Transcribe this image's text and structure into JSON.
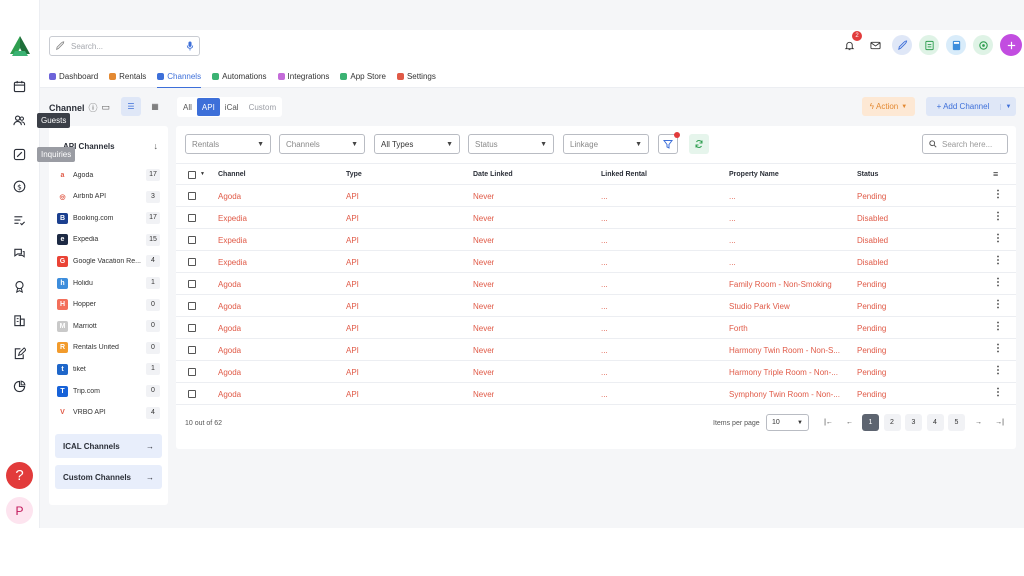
{
  "rail": {
    "tooltips": [
      "Guests",
      "Inquiries"
    ],
    "help_label": "?",
    "avatar_label": "P"
  },
  "topbar": {
    "search_placeholder": "Search...",
    "notification_count": "2"
  },
  "nav_tabs": [
    {
      "label": "Dashboard",
      "color": "#6c63d9"
    },
    {
      "label": "Rentals",
      "color": "#e38932"
    },
    {
      "label": "Channels",
      "color": "#3d6fd9",
      "active": true
    },
    {
      "label": "Automations",
      "color": "#3bb273"
    },
    {
      "label": "Integrations",
      "color": "#c46bd9"
    },
    {
      "label": "App Store",
      "color": "#3bb273"
    },
    {
      "label": "Settings",
      "color": "#e05a47"
    }
  ],
  "channel_header": {
    "title": "Channel",
    "filter_tabs": [
      "All",
      "API",
      "iCal",
      "Custom"
    ],
    "action_label": "Action",
    "add_channel_label": "+ Add Channel"
  },
  "sidebar": {
    "heading": "API Channels",
    "items": [
      {
        "name": "Agoda",
        "count": "17",
        "color": "#ffffff",
        "glyph": "a"
      },
      {
        "name": "Airbnb API",
        "count": "3",
        "color": "#ffffff",
        "glyph": "◎"
      },
      {
        "name": "Booking.com",
        "count": "17",
        "color": "#1b3f8f",
        "glyph": "B"
      },
      {
        "name": "Expedia",
        "count": "15",
        "color": "#1d2a44",
        "glyph": "e"
      },
      {
        "name": "Google Vacation Re...",
        "count": "4",
        "color": "#ea4335",
        "glyph": "G"
      },
      {
        "name": "Holidu",
        "count": "1",
        "color": "#3d8ddc",
        "glyph": "h"
      },
      {
        "name": "Hopper",
        "count": "0",
        "color": "#f36f5b",
        "glyph": "H"
      },
      {
        "name": "Marriott",
        "count": "0",
        "color": "#c9c9c9",
        "glyph": "M"
      },
      {
        "name": "Rentals United",
        "count": "0",
        "color": "#f29b2c",
        "glyph": "R"
      },
      {
        "name": "tiket",
        "count": "1",
        "color": "#1e66c9",
        "glyph": "t"
      },
      {
        "name": "Trip.com",
        "count": "0",
        "color": "#1762d8",
        "glyph": "T"
      },
      {
        "name": "VRBO API",
        "count": "4",
        "color": "#ffffff",
        "glyph": "V"
      }
    ],
    "ical_label": "ICAL Channels",
    "custom_label": "Custom Channels"
  },
  "filters": {
    "rentals": "Rentals",
    "channels": "Channels",
    "types": "All Types",
    "status": "Status",
    "linkage": "Linkage",
    "search_placeholder": "Search here..."
  },
  "table": {
    "columns": [
      "Channel",
      "Type",
      "Date Linked",
      "Linked Rental",
      "Property Name",
      "Status"
    ],
    "rows": [
      [
        "Agoda",
        "API",
        "Never",
        "...",
        "...",
        "Pending"
      ],
      [
        "Expedia",
        "API",
        "Never",
        "...",
        "...",
        "Disabled"
      ],
      [
        "Expedia",
        "API",
        "Never",
        "...",
        "...",
        "Disabled"
      ],
      [
        "Expedia",
        "API",
        "Never",
        "...",
        "...",
        "Disabled"
      ],
      [
        "Agoda",
        "API",
        "Never",
        "...",
        "Family Room - Non-Smoking",
        "Pending"
      ],
      [
        "Agoda",
        "API",
        "Never",
        "...",
        "Studio Park View",
        "Pending"
      ],
      [
        "Agoda",
        "API",
        "Never",
        "...",
        "Forth",
        "Pending"
      ],
      [
        "Agoda",
        "API",
        "Never",
        "...",
        "Harmony Twin Room - Non-S...",
        "Pending"
      ],
      [
        "Agoda",
        "API",
        "Never",
        "...",
        "Harmony Triple Room - Non-...",
        "Pending"
      ],
      [
        "Agoda",
        "API",
        "Never",
        "...",
        "Symphony Twin Room - Non-...",
        "Pending"
      ]
    ]
  },
  "pagination": {
    "count_text": "10 out of 62",
    "items_per_page_label": "Items per page",
    "items_per_page_value": "10",
    "pages": [
      "1",
      "2",
      "3",
      "4",
      "5"
    ],
    "first": "|←",
    "prev": "←",
    "next": "→",
    "last": "→|"
  }
}
